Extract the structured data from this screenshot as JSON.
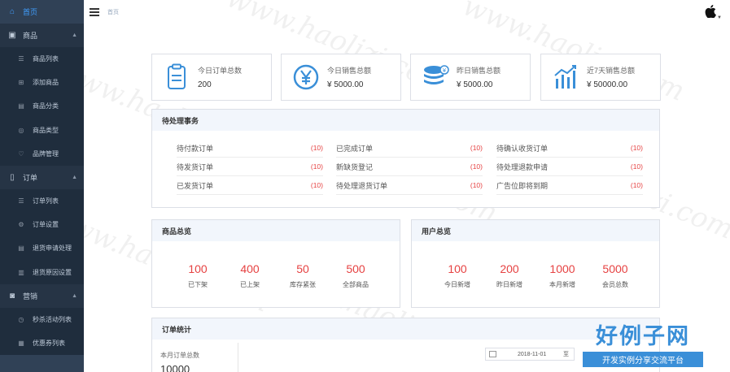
{
  "sidebar": {
    "home": "首页",
    "groups": [
      {
        "label": "商品",
        "items": [
          "商品列表",
          "添加商品",
          "商品分类",
          "商品类型",
          "品牌管理"
        ]
      },
      {
        "label": "订单",
        "items": [
          "订单列表",
          "订单设置",
          "退货申请处理",
          "退货原因设置"
        ]
      },
      {
        "label": "营销",
        "items": [
          "秒杀活动列表",
          "优惠券列表"
        ]
      }
    ]
  },
  "header": {
    "breadcrumb": "首页"
  },
  "stats": [
    {
      "title": "今日订单总数",
      "value": "200",
      "icon": "order-icon"
    },
    {
      "title": "今日销售总额",
      "value": "¥ 5000.00",
      "icon": "yen-icon"
    },
    {
      "title": "昨日销售总额",
      "value": "¥ 5000.00",
      "icon": "coins-icon"
    },
    {
      "title": "近7天销售总额",
      "value": "¥ 50000.00",
      "icon": "bar-chart-icon"
    }
  ],
  "todo": {
    "title": "待处理事务",
    "items": [
      {
        "label": "待付款订单",
        "count": "(10)"
      },
      {
        "label": "已完成订单",
        "count": "(10)"
      },
      {
        "label": "待确认收货订单",
        "count": "(10)"
      },
      {
        "label": "待发货订单",
        "count": "(10)"
      },
      {
        "label": "新缺货登记",
        "count": "(10)"
      },
      {
        "label": "待处理退款申请",
        "count": "(10)"
      },
      {
        "label": "已发货订单",
        "count": "(10)"
      },
      {
        "label": "待处理退货订单",
        "count": "(10)"
      },
      {
        "label": "广告位即将到期",
        "count": "(10)"
      }
    ]
  },
  "goods_overview": {
    "title": "商品总览",
    "items": [
      {
        "value": "100",
        "label": "已下架"
      },
      {
        "value": "400",
        "label": "已上架"
      },
      {
        "value": "50",
        "label": "库存紧张"
      },
      {
        "value": "500",
        "label": "全部商品"
      }
    ]
  },
  "user_overview": {
    "title": "用户总览",
    "items": [
      {
        "value": "100",
        "label": "今日新增"
      },
      {
        "value": "200",
        "label": "昨日新增"
      },
      {
        "value": "1000",
        "label": "本月新增"
      },
      {
        "value": "5000",
        "label": "会员总数"
      }
    ]
  },
  "order_stats": {
    "title": "订单统计",
    "month_label": "本月订单总数",
    "month_value": "10000",
    "date_start": "2018-11-01",
    "date_sep": "至"
  },
  "watermark": "www.haolizi.com",
  "brand": {
    "title": "好例子网",
    "subtitle": "开发实例分享交流平台"
  },
  "colors": {
    "sidebar_bg": "#304156",
    "accent": "#409EFF",
    "number_red": "#e64242",
    "panel_head": "#f2f6fc"
  }
}
